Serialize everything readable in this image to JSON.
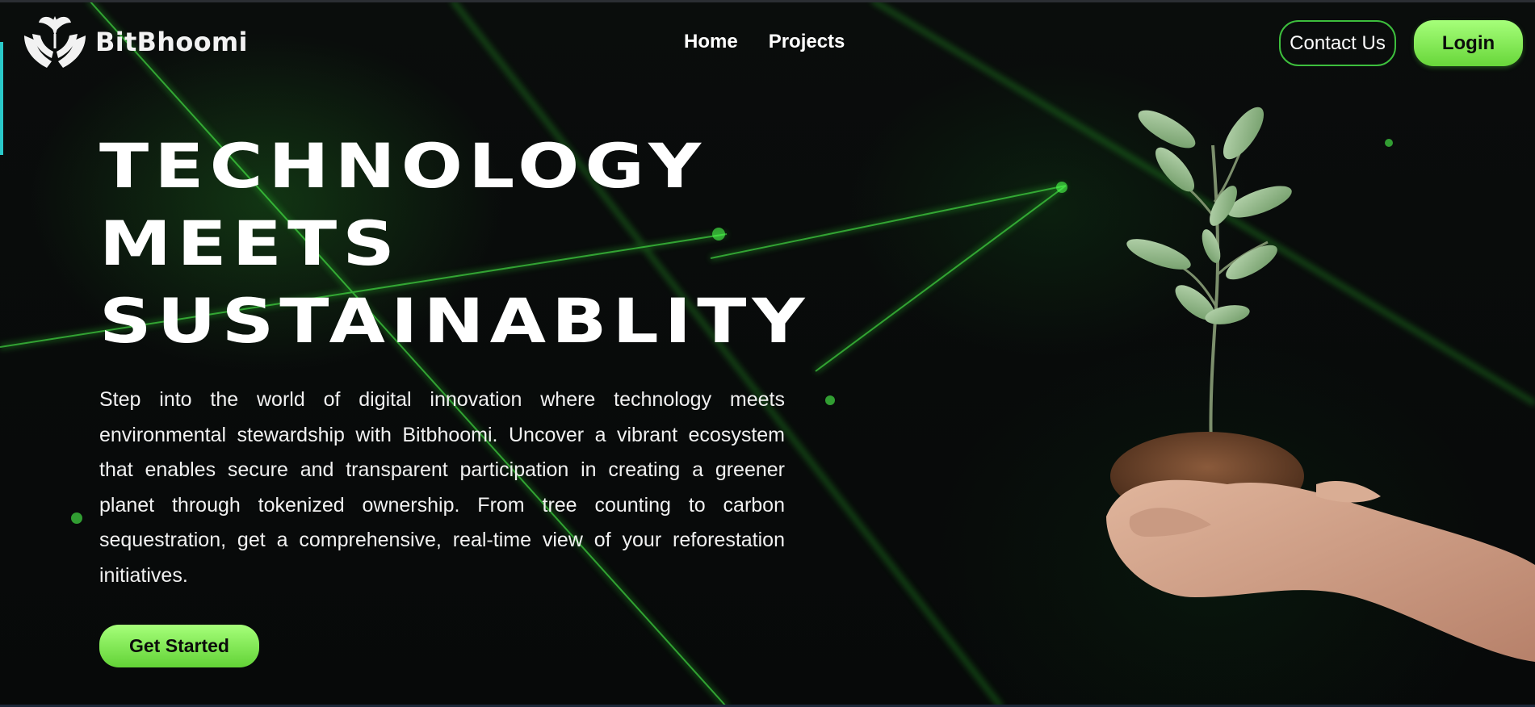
{
  "brand": {
    "name": "BitBhoomi",
    "logo_icon": "hands-holding-sprout-icon"
  },
  "nav": {
    "links": [
      {
        "label": "Home"
      },
      {
        "label": "Projects"
      }
    ],
    "contact_label": "Contact Us",
    "login_label": "Login"
  },
  "hero": {
    "headline_lines": [
      "TECHNOLOGY",
      "MEETS",
      "SUSTAINABLITY"
    ],
    "description": "Step into the world of digital innovation where technology meets environmental stewardship with Bitbhoomi. Uncover a vibrant ecosystem that enables secure and transparent participation in creating a greener planet through tokenized ownership. From tree counting to carbon sequestration, get a comprehensive, real-time view of your reforestation initiatives.",
    "cta_label": "Get Started",
    "image_icon": "hands-holding-seedling-icon"
  },
  "colors": {
    "accent_green": "#7ee85a",
    "contact_border": "#3dbe3d",
    "background": "#07090a",
    "edge_accent": "#2ac9c9"
  }
}
